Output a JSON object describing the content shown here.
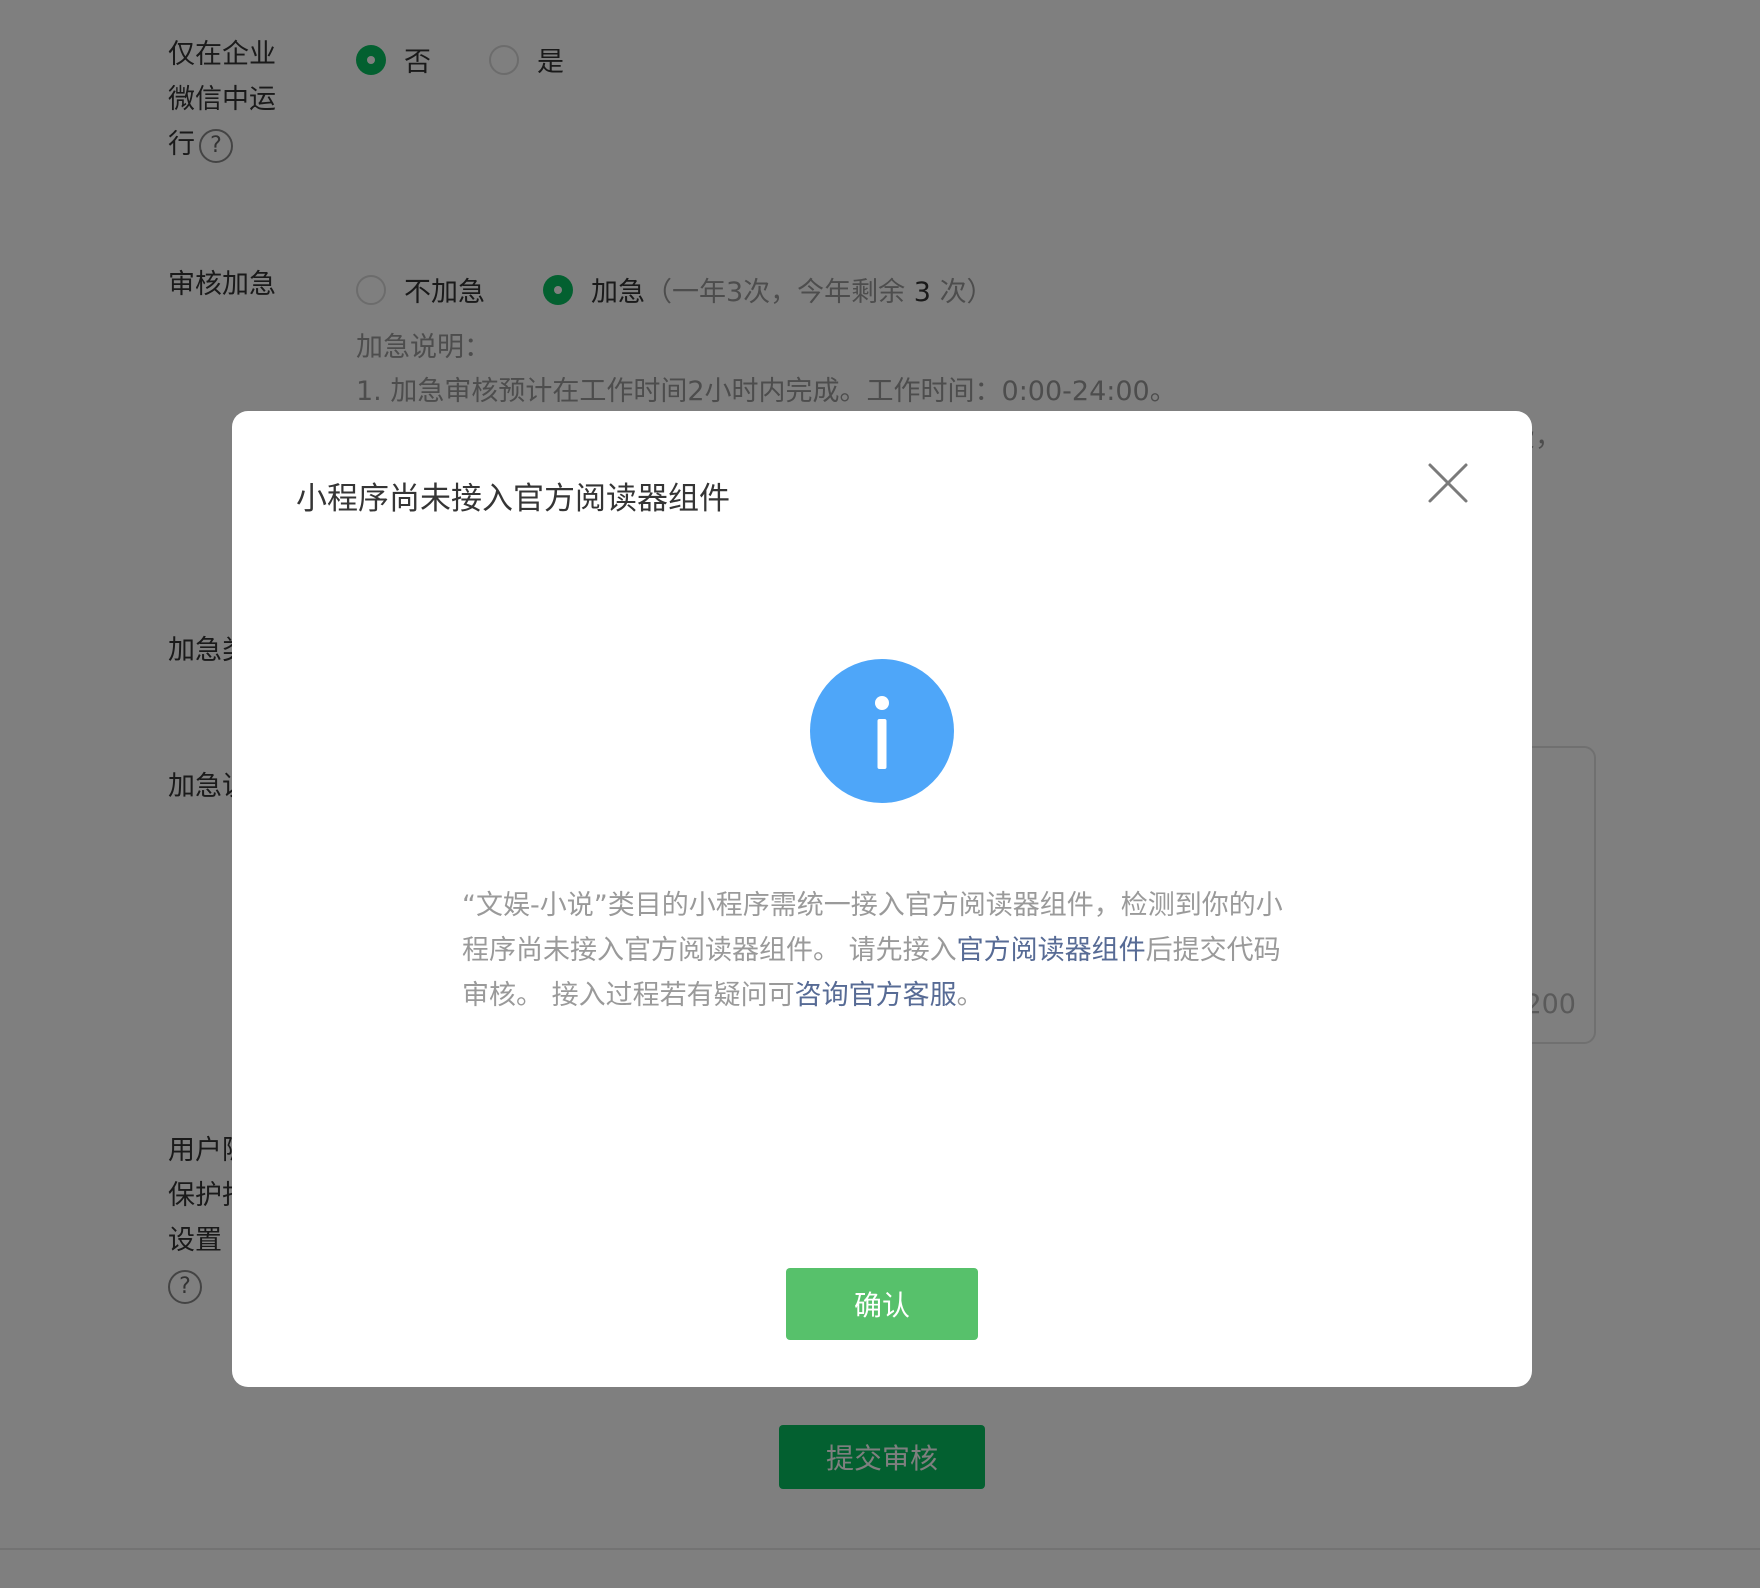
{
  "form": {
    "wecom_only": {
      "label": "仅在企业微信中运行",
      "options": [
        "否",
        "是"
      ],
      "selected": "否"
    },
    "urgent_review": {
      "label": "审核加急",
      "option_no": "不加急",
      "option_yes": "加急",
      "quota_prefix": "（一年3次，今年剩余",
      "quota_remaining": "3",
      "quota_suffix": "次）",
      "selected": "加急",
      "explain_title": "加急说明：",
      "explain_line1": "1. 加急审核预计在工作时间2小时内完成。工作时间：0:00-24:00。",
      "explain_line2_tail": "费，"
    },
    "urgent_type_label_partial": "加急类",
    "urgent_desc_label_partial": "加急说",
    "char_count_partial": "200",
    "privacy_label_partial": [
      "用户隐",
      "保护指",
      "设置"
    ],
    "submit_label": "提交审核"
  },
  "dialog": {
    "title": "小程序尚未接入官方阅读器组件",
    "icon": "info-icon",
    "message_part1": "“文娱-小说”类目的小程序需统一接入官方阅读器组件，检测到你的小程序尚未接入官方阅读器组件。 请先接入",
    "link1": "官方阅读器组件",
    "message_part2": "后提交代码审核。 接入过程若有疑问可",
    "link2": "咨询官方客服",
    "message_part3": "。",
    "confirm_label": "确认"
  },
  "colors": {
    "brand_green": "#07c160",
    "confirm_green": "#57c16b",
    "info_blue": "#4ea6f9",
    "link_blue": "#576b95",
    "overlay": "rgba(0,0,0,0.5)"
  }
}
